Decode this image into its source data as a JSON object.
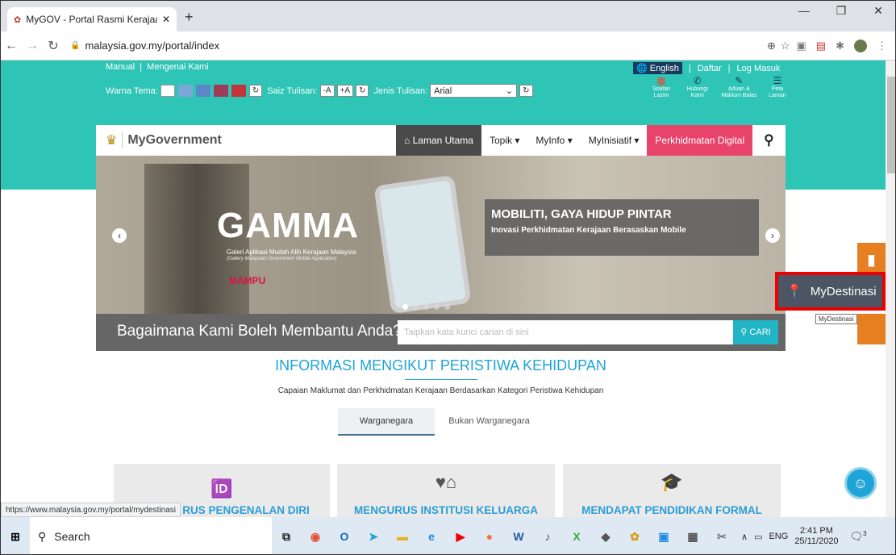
{
  "browser": {
    "tab_title": "MyGOV - Portal Rasmi Kerajaan M",
    "url": "malaysia.gov.my/portal/index",
    "status_url": "https://www.malaysia.gov.my/portal/mydestinasi"
  },
  "topbar": {
    "manual": "Manual",
    "about": "Mengenai Kami",
    "theme_label": "Warna Tema:",
    "text_size_label": "Saiz Tulisan:",
    "text_minus": "-A",
    "text_plus": "+A",
    "font_label": "Jenis Tulisan:",
    "font_value": "Arial",
    "english": "English",
    "register": "Daftar",
    "login": "Log Masuk",
    "quick_links": [
      "Soalan Lazim",
      "Hubungi Kami",
      "Aduan & Maklum Balas",
      "Peta Laman"
    ],
    "theme_colors": [
      "#ffffff",
      "#7ba7d8",
      "#5b87c6",
      "#a23a5a",
      "#c4333c"
    ]
  },
  "nav": {
    "logo_text": "MyGovernment",
    "items": [
      "Laman Utama",
      "Topik",
      "MyInfo",
      "MyInisiatif"
    ],
    "digital_button": "Perkhidmatan Digital"
  },
  "hero": {
    "brand": "GAMMA",
    "brand_sub1": "Galeri Aplikasi Mudah Alih Kerajaan Malaysia",
    "brand_sub2": "(Gallery Malaysian Government Mobile Application)",
    "mampu": "MAMPU",
    "caption_title": "MOBILITI, GAYA HIDUP PINTAR",
    "caption_sub": "Inovasi Perkhidmatan Kerajaan Berasaskan Mobile"
  },
  "help": {
    "heading": "Bagaimana Kami Boleh Membantu Anda?",
    "placeholder": "Taipkan kata kunci carian di sini",
    "search_button": "CARI"
  },
  "side": {
    "mydestinasi": "MyDestinasi",
    "tooltip": "MyDestinasi"
  },
  "section": {
    "title": "INFORMASI MENGIKUT PERISTIWA KEHIDUPAN",
    "subtitle": "Capaian Maklumat dan Perkhidmatan Kerajaan Berdasarkan Kategori Peristiwa Kehidupan",
    "tabs": [
      "Warganegara",
      "Bukan Warganegara"
    ],
    "cards": [
      "RUS PENGENALAN DIRI",
      "MENGURUS INSTITUSI KELUARGA",
      "MENDAPAT PENDIDIKAN FORMAL"
    ]
  },
  "taskbar": {
    "search": "Search",
    "lang": "ENG",
    "time": "2:41 PM",
    "date": "25/11/2020",
    "notif_count": "3"
  }
}
